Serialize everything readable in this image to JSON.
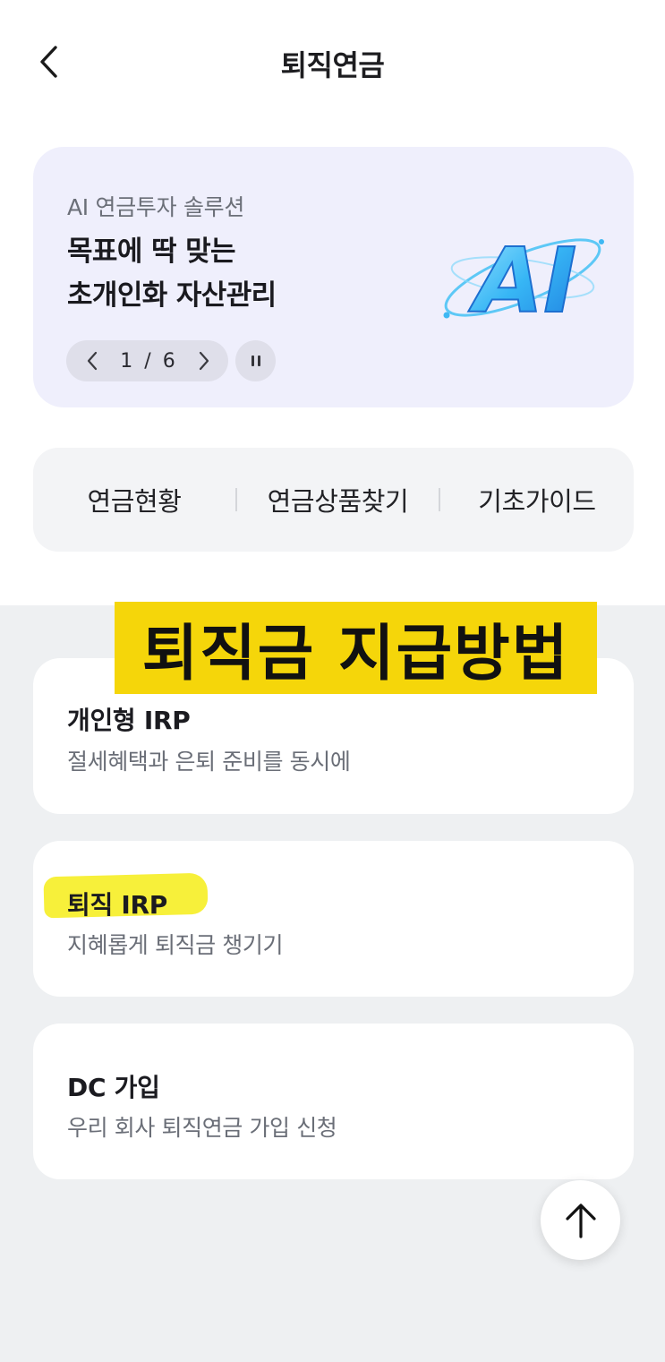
{
  "header": {
    "title": "퇴직연금",
    "back_icon": "chevron-left-icon"
  },
  "banner": {
    "subtitle": "AI 연금투자 솔루션",
    "title_lines": [
      "목표에 딱 맞는",
      "초개인화 자산관리"
    ],
    "pager": {
      "current": "1",
      "separator": "/",
      "total": "6"
    },
    "image_icon": "ai-3d-logo",
    "image_text": "AI",
    "background_color": "#efeffc"
  },
  "quick_menu": {
    "items": [
      "연금현황",
      "연금상품찾기",
      "기초가이드"
    ]
  },
  "overlay_caption": {
    "text": "퇴직금 지급방법",
    "background_color": "#f5d60a"
  },
  "cards": [
    {
      "title": "개인형 IRP",
      "desc": "절세혜택과 은퇴 준비를 동시에"
    },
    {
      "title": "퇴직 IRP",
      "desc": "지혜롭게 퇴직금 챙기기",
      "highlight_color": "#f7f03a"
    },
    {
      "title": "DC 가입",
      "desc": "우리 회사 퇴직연금 가입 신청"
    }
  ],
  "scroll_top": {
    "icon": "arrow-up-icon"
  }
}
